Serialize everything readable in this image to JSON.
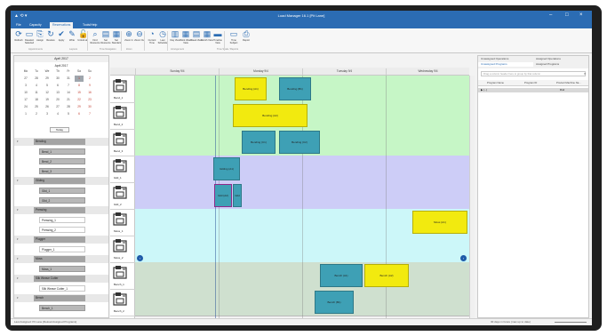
{
  "window": {
    "title": "Load Manager 16.1 [Pit Lane]",
    "quick_access": "▲ ⟲ ▾"
  },
  "ribbon_tabs": [
    "File",
    "Capacity",
    "Reservations",
    "Tools/Help"
  ],
  "ribbon_buttons": [
    {
      "label": "Refresh",
      "icon": "refresh-icon",
      "glyph": "⟳"
    },
    {
      "label": "Deselect Selected",
      "icon": "deselect-icon",
      "glyph": "▭"
    },
    {
      "label": "Assign",
      "icon": "assign-icon",
      "glyph": "⎘"
    },
    {
      "label": "Resolve",
      "icon": "resolve-icon",
      "glyph": "↻"
    },
    {
      "label": "Apply",
      "icon": "apply-icon",
      "glyph": "✔"
    },
    {
      "label": "Write",
      "icon": "write-icon",
      "glyph": "✎"
    },
    {
      "label": "Unlock all",
      "icon": "unlock-icon",
      "glyph": "🔓"
    },
    {
      "label": "Find Resource",
      "icon": "find-resource-icon",
      "glyph": "⌕"
    },
    {
      "label": "Set Resource",
      "icon": "set-resource-icon",
      "glyph": "▤"
    },
    {
      "label": "Set Standard",
      "icon": "set-standard-icon",
      "glyph": "▦"
    },
    {
      "label": "Zoom In",
      "icon": "zoom-in-icon",
      "glyph": "⊕"
    },
    {
      "label": "Zoom Out",
      "icon": "zoom-out-icon",
      "glyph": "⊖"
    },
    {
      "label": "Current Time",
      "icon": "current-time-icon",
      "glyph": "◔"
    },
    {
      "label": "Last Schedule",
      "icon": "last-schedule-icon",
      "glyph": "◷"
    },
    {
      "label": "Day View",
      "icon": "day-view-icon",
      "glyph": "▥"
    },
    {
      "label": "Work Week View",
      "icon": "work-week-icon",
      "glyph": "▦"
    },
    {
      "label": "Week View",
      "icon": "week-view-icon",
      "glyph": "▤"
    },
    {
      "label": "Month View",
      "icon": "month-view-icon",
      "glyph": "▦"
    },
    {
      "label": "Timeline View",
      "icon": "timeline-view-icon",
      "glyph": "▬"
    },
    {
      "label": "Time Subject",
      "icon": "time-subject-icon",
      "glyph": "▭"
    },
    {
      "label": "Report",
      "icon": "report-icon",
      "glyph": "⎙"
    }
  ],
  "ribbon_groups": [
    "Appointments",
    "Layouts",
    "Time Navigation",
    "Zoom",
    "Arrangement",
    "Time Scale / Reports"
  ],
  "calendar": {
    "header": "April 2017",
    "subheader": "April 2017",
    "weekdays": [
      "Mo",
      "Tu",
      "We",
      "Th",
      "Fr",
      "Sa",
      "Su"
    ],
    "weeks": [
      [
        "27",
        "28",
        "29",
        "30",
        "31",
        "1",
        "2"
      ],
      [
        "3",
        "4",
        "5",
        "6",
        "7",
        "8",
        "9"
      ],
      [
        "10",
        "11",
        "12",
        "13",
        "14",
        "15",
        "16"
      ],
      [
        "17",
        "18",
        "19",
        "20",
        "21",
        "22",
        "23"
      ],
      [
        "24",
        "25",
        "26",
        "27",
        "28",
        "29",
        "30"
      ],
      [
        "1",
        "2",
        "3",
        "4",
        "5",
        "6",
        "7"
      ]
    ],
    "selected": "2",
    "today_label": "Today"
  },
  "tree": [
    {
      "type": "grp",
      "label": "Bending"
    },
    {
      "type": "child",
      "label": "Bend_1",
      "shaded": true
    },
    {
      "type": "child",
      "label": "Bend_2",
      "shaded": true
    },
    {
      "type": "child",
      "label": "Bend_3",
      "shaded": true
    },
    {
      "type": "grp",
      "label": "Gilding"
    },
    {
      "type": "child",
      "label": "Gild_1",
      "shaded": true
    },
    {
      "type": "child",
      "label": "Gild_2",
      "shaded": true
    },
    {
      "type": "grp",
      "label": "Pressing"
    },
    {
      "type": "child",
      "label": "Pressing_1",
      "shaded": false
    },
    {
      "type": "child",
      "label": "Pressing_2",
      "shaded": false
    },
    {
      "type": "grp",
      "label": "Plugger"
    },
    {
      "type": "child",
      "label": "Plugger_1",
      "shaded": false
    },
    {
      "type": "grp",
      "label": "Moss"
    },
    {
      "type": "child",
      "label": "Moss_1",
      "shaded": true
    },
    {
      "type": "grp",
      "label": "Silk Weave Cutter"
    },
    {
      "type": "child",
      "label": "Silk Weave Cutter_1",
      "shaded": false
    },
    {
      "type": "grp",
      "label": "Bench"
    },
    {
      "type": "child",
      "label": "Bench_1",
      "shaded": true
    }
  ],
  "resources": [
    "Bend_1",
    "Bend_2",
    "Bend_3",
    "Gild_1",
    "Gild_2",
    "Moss_1",
    "Moss_2",
    "Bench_1",
    "Bench_2"
  ],
  "days": [
    "Sunday 9/4",
    "Monday 9/4",
    "Tuesday 9/4",
    "Wednesday 9/4"
  ],
  "appointments": [
    {
      "lane": 0,
      "text": "Bending (A1)",
      "color": "y",
      "selected": false
    },
    {
      "lane": 0,
      "text": "Bending (B1)",
      "color": "b",
      "selected": false
    },
    {
      "lane": 1,
      "text": "Bending (A2)",
      "color": "y",
      "selected": false
    },
    {
      "lane": 2,
      "text": "Bending (C1)",
      "color": "b",
      "selected": false
    },
    {
      "lane": 2,
      "text": "Bending (C2)",
      "color": "b",
      "selected": false
    },
    {
      "lane": 3,
      "text": "Gilding (A1)",
      "color": "b",
      "selected": false
    },
    {
      "lane": 4,
      "text": "Gild (A2)",
      "color": "b",
      "selected": true
    },
    {
      "lane": 4,
      "text": "Gild",
      "color": "b",
      "selected": false
    },
    {
      "lane": 5,
      "text": "Moss (A1)",
      "color": "y",
      "selected": false
    },
    {
      "lane": 7,
      "text": "Bench (A1)",
      "color": "b",
      "selected": false
    },
    {
      "lane": 7,
      "text": "Bench (A2)",
      "color": "y",
      "selected": false
    },
    {
      "lane": 8,
      "text": "Bench (B1)",
      "color": "b",
      "selected": false
    }
  ],
  "lane_colors": [
    "#c6f6c6",
    "#c6f6c6",
    "#c6f6c6",
    "#cdcdf7",
    "#cdcdf7",
    "#ccf7f9",
    "#ccf7f9",
    "#cfe0cf",
    "#cfe0cf"
  ],
  "right_pane": {
    "tabs": [
      "Unassigned Operations",
      "Assigned Operations",
      "Unassigned Programs",
      "Assigned Programs"
    ],
    "search_placeholder": "Drag a column header here to group by that column",
    "columns": [
      "Program Name",
      "Program ID",
      "Product Machine Na..."
    ],
    "row_left": "▶ (...)",
    "row_right": "Rnd"
  },
  "status": {
    "left": "Last Assigned: Pit Lane   [Reload Assigned Programs]",
    "right": "30 days in future (max up to date)"
  }
}
